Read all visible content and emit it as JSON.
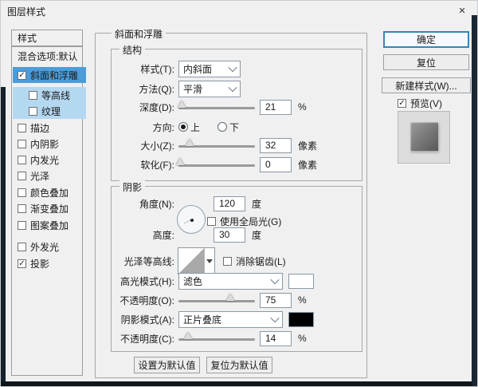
{
  "window": {
    "title": "图层样式",
    "close": "×"
  },
  "sidebar": {
    "header": "样式",
    "items": [
      {
        "label": "混合选项:默认",
        "has_checkbox": false,
        "checked": false,
        "selected": false
      },
      {
        "label": "斜面和浮雕",
        "has_checkbox": true,
        "checked": true,
        "selected": true
      },
      {
        "label": "等高线",
        "has_checkbox": true,
        "checked": false,
        "selected": "sub"
      },
      {
        "label": "纹理",
        "has_checkbox": true,
        "checked": false,
        "selected": "sub"
      },
      {
        "label": "描边",
        "has_checkbox": true,
        "checked": false,
        "selected": false
      },
      {
        "label": "内阴影",
        "has_checkbox": true,
        "checked": false,
        "selected": false
      },
      {
        "label": "内发光",
        "has_checkbox": true,
        "checked": false,
        "selected": false
      },
      {
        "label": "光泽",
        "has_checkbox": true,
        "checked": false,
        "selected": false
      },
      {
        "label": "颜色叠加",
        "has_checkbox": true,
        "checked": false,
        "selected": false
      },
      {
        "label": "渐变叠加",
        "has_checkbox": true,
        "checked": false,
        "selected": false
      },
      {
        "label": "图案叠加",
        "has_checkbox": true,
        "checked": false,
        "selected": false
      },
      {
        "label": "外发光",
        "has_checkbox": true,
        "checked": false,
        "selected": false
      },
      {
        "label": "投影",
        "has_checkbox": true,
        "checked": true,
        "selected": false
      }
    ]
  },
  "panel": {
    "title": "斜面和浮雕",
    "structure": {
      "title": "结构",
      "style_label": "样式(T):",
      "style_value": "内斜面",
      "technique_label": "方法(Q):",
      "technique_value": "平滑",
      "depth_label": "深度(D):",
      "depth_value": "21",
      "depth_unit": "%",
      "direction_label": "方向:",
      "direction_up": "上",
      "direction_down": "下",
      "direction_selected": "上",
      "size_label": "大小(Z):",
      "size_value": "32",
      "size_unit": "像素",
      "soften_label": "软化(F):",
      "soften_value": "0",
      "soften_unit": "像素"
    },
    "shading": {
      "title": "阴影",
      "angle_label": "角度(N):",
      "angle_value": "120",
      "angle_unit": "度",
      "global_light_label": "使用全局光(G)",
      "global_light_checked": false,
      "altitude_label": "高度:",
      "altitude_value": "30",
      "altitude_unit": "度",
      "gloss_contour_label": "光泽等高线:",
      "anti_alias_label": "消除锯齿(L)",
      "anti_alias_checked": false,
      "highlight_mode_label": "高光模式(H):",
      "highlight_mode_value": "滤色",
      "highlight_color": "#ffffff",
      "highlight_opacity_label": "不透明度(O):",
      "highlight_opacity_value": "75",
      "highlight_opacity_unit": "%",
      "shadow_mode_label": "阴影模式(A):",
      "shadow_mode_value": "正片叠底",
      "shadow_color": "#000000",
      "shadow_opacity_label": "不透明度(C):",
      "shadow_opacity_value": "14",
      "shadow_opacity_unit": "%"
    },
    "footer": {
      "set_default": "设置为默认值",
      "reset_default": "复位为默认值"
    }
  },
  "actions": {
    "ok": "确定",
    "reset": "复位",
    "new_style": "新建样式(W)...",
    "preview_label": "预览(V)",
    "preview_checked": true
  },
  "colors": {
    "selected_row": "#4c9cd8",
    "sub_row": "#b5d8f1",
    "ok_border": "#3487b8",
    "highlight_swatch": "#ffffff",
    "shadow_swatch": "#000000"
  }
}
